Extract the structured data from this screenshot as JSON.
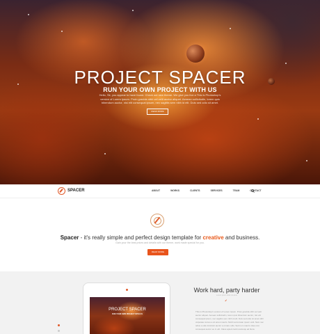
{
  "hero": {
    "title": "PROJECT SPACER",
    "subtitle": "RUN YOUR OWN PROJECT WITH US",
    "text": "Hello, Sir, you appear to have found. Check out new theme. We give you live a This is Photoshop's version of Lorem Ipsum. Proin gravida nibh vel velit auctor aliquet. Aenean sollicitudin, lorem quis bibendum auctor, nisi elit consequat ipsum, nec sagittis sem nibh id elit. Duis sed odio sit amet.",
    "button": "READ MORE"
  },
  "nav": {
    "logo": "SPACER",
    "items": [
      "ABOUT",
      "WORKS",
      "CLIENTS",
      "SERVICES",
      "TEAM",
      "CONTACT"
    ]
  },
  "intro": {
    "brand": "Spacer",
    "text_before": " - it's really simple and perfect design template for ",
    "accent": "creative",
    "text_after": " and business.",
    "subtitle": "Gain your the best prices and details with our theme, work made special for you.",
    "button": "READ MORE"
  },
  "tablet": {
    "title": "PROJECT SPACER",
    "subtitle": "RUN YOUR OWN PROJECT WITH US"
  },
  "work": {
    "title": "Work hard, party harder",
    "subtitle": "Lorem ipsum dolor sit amet",
    "text": "This is Photoshop's version of Lorem Ipsum. Proin gravida nibh vel velit auctor aliquet. Aenean sollicitudin, lorem quis bibendum auctor, nisi elit consequat ipsum, nec sagittis sem nibh id elit. Duis sed odio sit amet nibh vulputate cursus a sit amet mauris. Morbi accumsan ipsum velit. Nam nec tellus a odio tincidunt auctor a ornare odio. Sed non mauris vitae erat consequat auctor eu in elit. Class aptent taciti sociosqu ad litora."
  },
  "colors": {
    "accent": "#e8541c",
    "hero_dark": "#4a1608"
  },
  "icons": [
    "compass-logo-icon",
    "search-icon",
    "compass-emblem-icon",
    "rocket-icon"
  ]
}
